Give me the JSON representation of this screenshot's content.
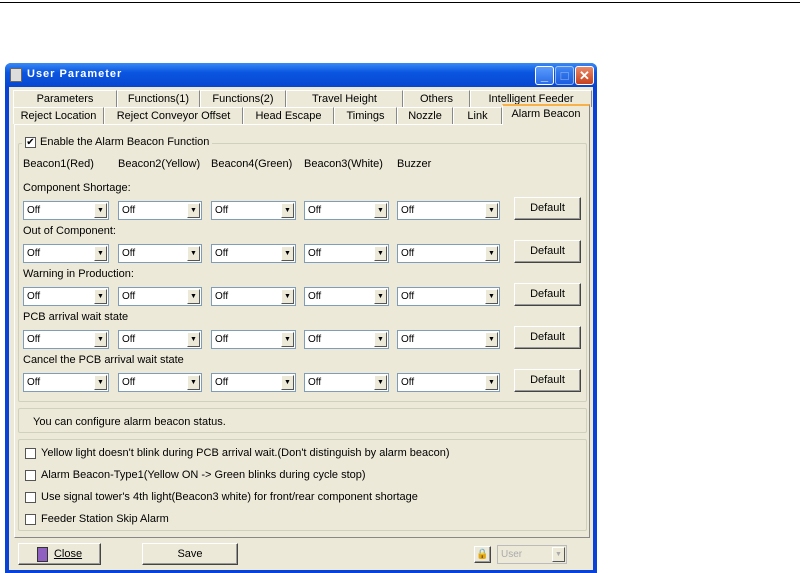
{
  "window": {
    "title": "User Parameter"
  },
  "tabs_row1": [
    "Parameters",
    "Functions(1)",
    "Functions(2)",
    "Travel Height",
    "Others",
    "Intelligent Feeder"
  ],
  "tabs_row2": [
    "Reject Location",
    "Reject Conveyor Offset",
    "Head Escape",
    "Timings",
    "Nozzle",
    "Link",
    "Alarm Beacon"
  ],
  "enable": {
    "label": "Enable the Alarm Beacon Function",
    "checked": true
  },
  "columns": [
    "Beacon1(Red)",
    "Beacon2(Yellow)",
    "Beacon4(Green)",
    "Beacon3(White)",
    "Buzzer"
  ],
  "rows": [
    {
      "label": "Component Shortage:",
      "values": [
        "Off",
        "Off",
        "Off",
        "Off",
        "Off"
      ],
      "button": "Default"
    },
    {
      "label": "Out of Component:",
      "values": [
        "Off",
        "Off",
        "Off",
        "Off",
        "Off"
      ],
      "button": "Default"
    },
    {
      "label": "Warning in Production:",
      "values": [
        "Off",
        "Off",
        "Off",
        "Off",
        "Off"
      ],
      "button": "Default"
    },
    {
      "label": "PCB arrival wait state",
      "values": [
        "Off",
        "Off",
        "Off",
        "Off",
        "Off"
      ],
      "button": "Default"
    },
    {
      "label": "Cancel the PCB arrival wait state",
      "values": [
        "Off",
        "Off",
        "Off",
        "Off",
        "Off"
      ],
      "button": "Default"
    }
  ],
  "status": "You can configure alarm beacon status.",
  "options": [
    {
      "label": "Yellow light doesn't blink during PCB arrival wait.(Don't distinguish by alarm beacon)",
      "checked": false
    },
    {
      "label": "Alarm Beacon-Type1(Yellow ON -> Green blinks during cycle stop)",
      "checked": false
    },
    {
      "label": "Use signal tower's 4th light(Beacon3 white) for front/rear component shortage",
      "checked": false
    },
    {
      "label": "Feeder Station Skip Alarm",
      "checked": false
    }
  ],
  "footer": {
    "close": "Close",
    "save": "Save",
    "user": "User"
  }
}
